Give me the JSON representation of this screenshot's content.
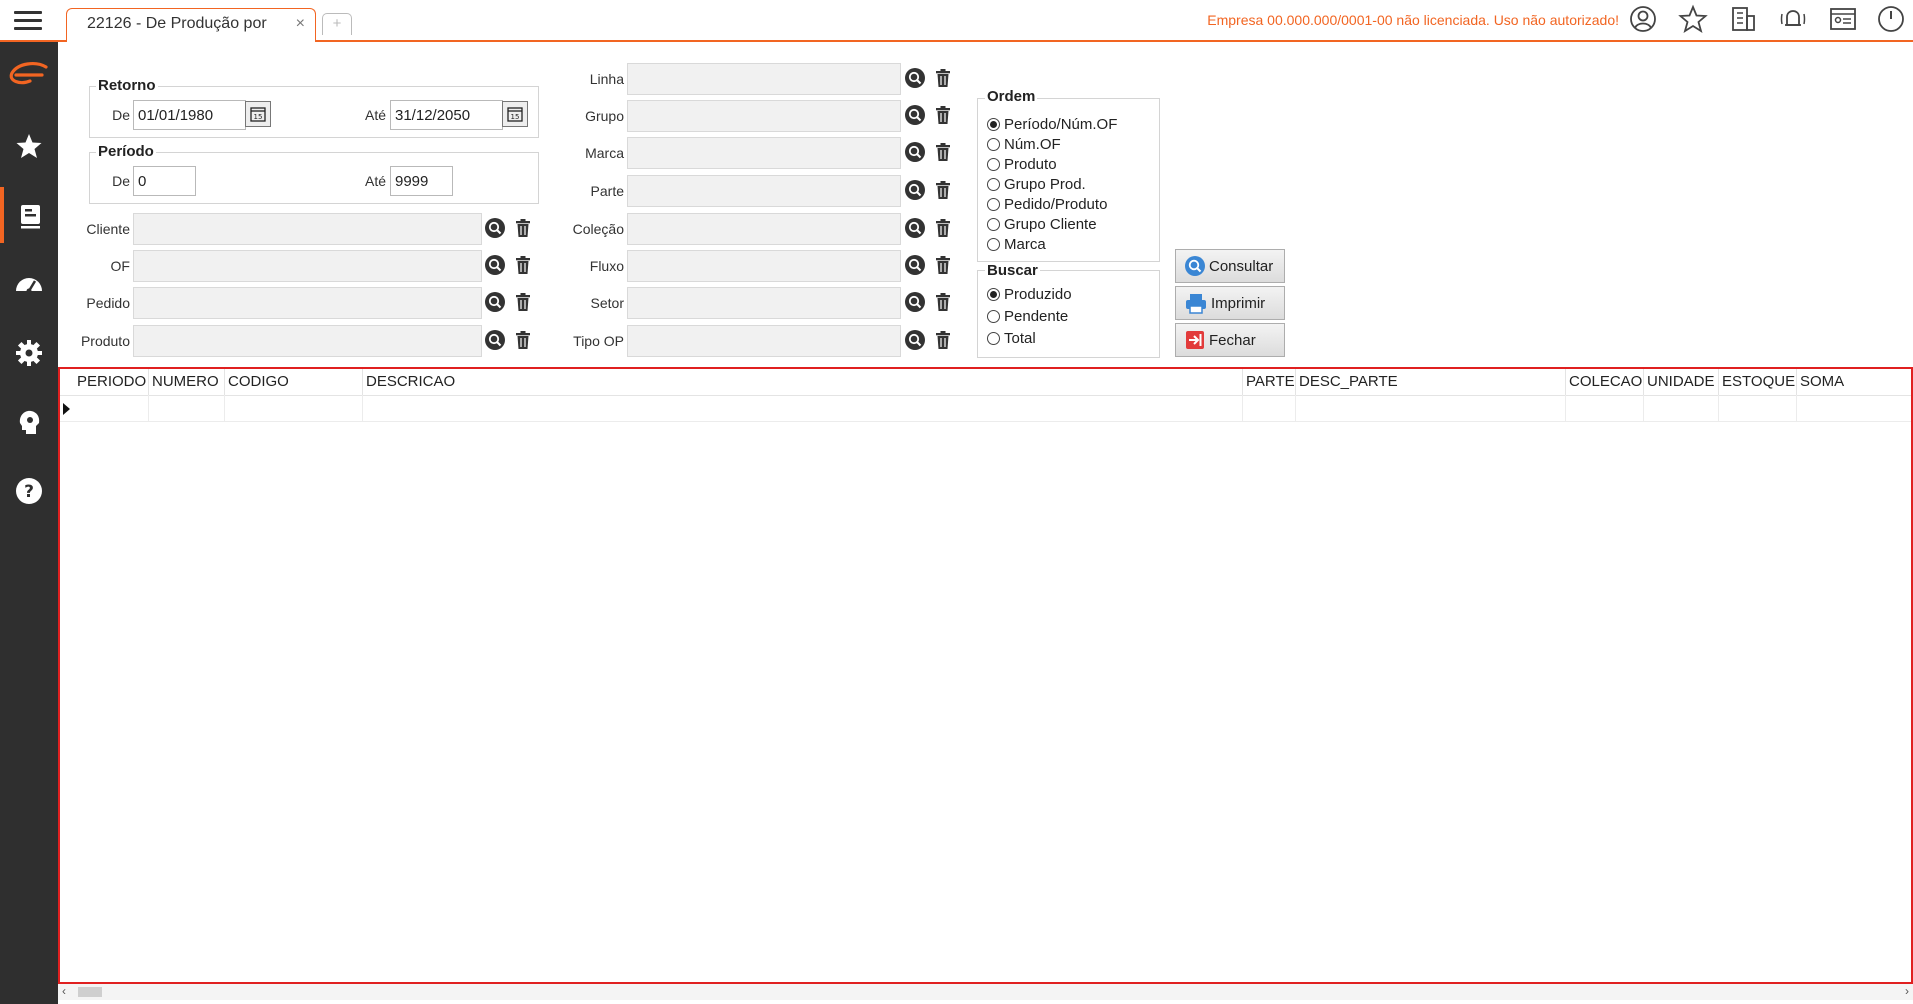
{
  "topbar": {
    "tab_label": "22126 - De Produção por",
    "tab_close": "×",
    "new_tab": "+",
    "license_text": "Empresa 00.000.000/0001-00 não licenciada. Uso não autorizado!"
  },
  "retorno": {
    "legend": "Retorno",
    "de_label": "De",
    "de_value": "01/01/1980",
    "ate_label": "Até",
    "ate_value": "31/12/2050"
  },
  "periodo": {
    "legend": "Período",
    "de_label": "De",
    "de_value": "0",
    "ate_label": "Até",
    "ate_value": "9999"
  },
  "left_filters": [
    "Cliente",
    "OF",
    "Pedido",
    "Produto"
  ],
  "middle_filters": [
    "Linha",
    "Grupo",
    "Marca",
    "Parte",
    "Coleção",
    "Fluxo",
    "Setor",
    "Tipo OP"
  ],
  "ordem": {
    "legend": "Ordem",
    "options": [
      "Período/Núm.OF",
      "Núm.OF",
      "Produto",
      "Grupo Prod.",
      "Pedido/Produto",
      "Grupo Cliente",
      "Marca"
    ],
    "selected_index": 0
  },
  "buscar": {
    "legend": "Buscar",
    "options": [
      "Produzido",
      "Pendente",
      "Total"
    ],
    "selected_index": 0
  },
  "buttons": {
    "consultar": "Consultar",
    "imprimir": "Imprimir",
    "fechar": "Fechar"
  },
  "grid": {
    "columns": [
      "PERIODO",
      "NUMERO",
      "CODIGO",
      "DESCRICAO",
      "PARTE",
      "DESC_PARTE",
      "COLECAO",
      "UNIDADE",
      "ESTOQUE",
      "SOMA"
    ]
  },
  "colors": {
    "accent": "#f26522",
    "sidebar": "#2f2f2f",
    "grid_border": "#e02020"
  }
}
